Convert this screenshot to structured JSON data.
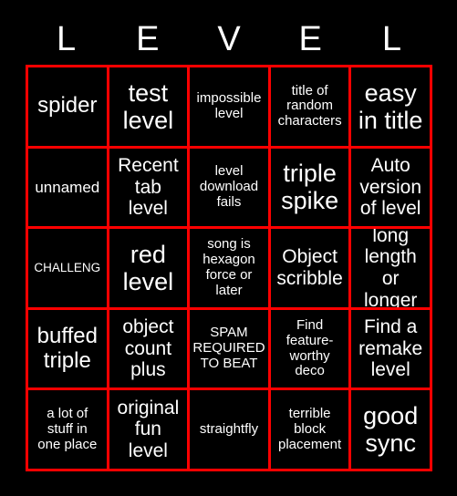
{
  "card": {
    "title": "LEVEL",
    "header_letters": [
      "L",
      "E",
      "V",
      "E",
      "L"
    ],
    "colors": {
      "background": "#000000",
      "border": "#ff0000",
      "text": "#ffffff"
    },
    "grid_size": "5x5",
    "rows": [
      [
        {
          "text": "spider",
          "size": "lg"
        },
        {
          "text": "test\nlevel",
          "size": "xl"
        },
        {
          "text": "impossible\nlevel",
          "size": "xs"
        },
        {
          "text": "title of\nrandom\ncharacters",
          "size": "xs"
        },
        {
          "text": "easy\nin title",
          "size": "xl"
        }
      ],
      [
        {
          "text": "unnamed",
          "size": "sm"
        },
        {
          "text": "Recent\ntab\nlevel",
          "size": "md"
        },
        {
          "text": "level\ndownload\nfails",
          "size": "xs"
        },
        {
          "text": "triple\nspike",
          "size": "xl"
        },
        {
          "text": "Auto\nversion\nof level",
          "size": "md"
        }
      ],
      [
        {
          "text": "CHALLENG",
          "size": "xxs",
          "clip": true
        },
        {
          "text": "red\nlevel",
          "size": "xl"
        },
        {
          "text": "song is\nhexagon\nforce or\nlater",
          "size": "xs"
        },
        {
          "text": "Object\nscribble",
          "size": "md"
        },
        {
          "text": "long\nlength or\nlonger",
          "size": "md"
        }
      ],
      [
        {
          "text": "buffed\ntriple",
          "size": "lg"
        },
        {
          "text": "object\ncount\nplus",
          "size": "md"
        },
        {
          "text": "SPAM\nREQUIRED\nTO BEAT",
          "size": "xs"
        },
        {
          "text": "Find\nfeature-\nworthy\ndeco",
          "size": "xs"
        },
        {
          "text": "Find a\nremake\nlevel",
          "size": "md"
        }
      ],
      [
        {
          "text": "a lot of\nstuff in\none place",
          "size": "xs"
        },
        {
          "text": "original\nfun\nlevel",
          "size": "md"
        },
        {
          "text": "straightfly",
          "size": "xs"
        },
        {
          "text": "terrible\nblock\nplacement",
          "size": "xs"
        },
        {
          "text": "good\nsync",
          "size": "xl"
        }
      ]
    ]
  }
}
